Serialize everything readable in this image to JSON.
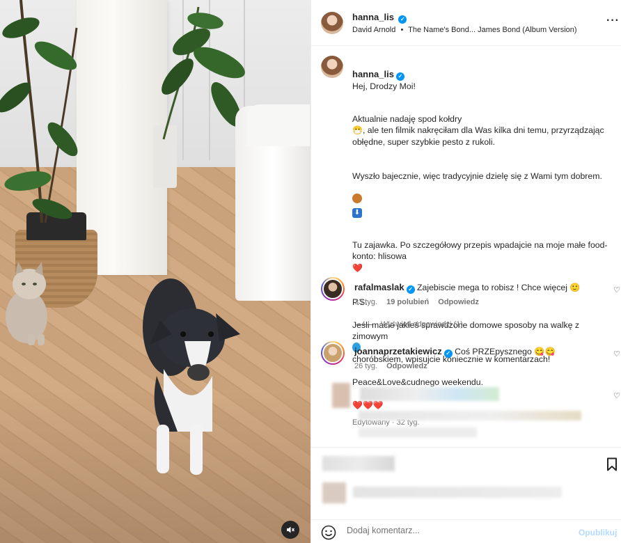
{
  "post": {
    "username": "hanna_lis",
    "verified": true,
    "music_artist": "David Arnold",
    "music_separator": "•",
    "music_track": "The Name's Bond... James Bond (Album Version)",
    "more_icon": "more-horizontal-icon"
  },
  "caption": {
    "username": "hanna_lis",
    "greeting": "Hej, Drodzy Moi!",
    "p1_a": "Aktualnie nadaję spod kołdry",
    "p1_b": ", ale ten filmik nakręciłam dla Was kilka dni temu, przyrządzając obłędne, super szybkie pesto z rukoli.",
    "p2": "Wyszło bajecznie, więc tradycyjnie dzielę się z Wami tym dobrem.",
    "p3": "Tu zajawka. Po szczegółowy przepis wpadajcie na moje małe food-konto: hlisowa",
    "p4_a": "P.S.",
    "p4_b": "Jeśli macie jakieś sprawdzone domowe sposoby na walkę z zimowym",
    "p4_c": "choróbskiem, wpisujcie koniecznie w komentarzach!",
    "p4_d": "Peace&Love&cudnego weekendu.",
    "emoji_sick": "😷",
    "emoji_heart": "❤️",
    "emoji_hearts": "❤️❤️❤️",
    "meta": "Edytowany · 32 tyg."
  },
  "comments": [
    {
      "username": "rafalmaslak",
      "verified": true,
      "text": "Zajebiscie mega to robisz ! Chce więcej",
      "emoji": "🙂",
      "time": "33 tyg.",
      "likes": "19 polubień",
      "reply": "Odpowiedz"
    },
    {
      "username": "joannaprzetakiewicz",
      "verified": true,
      "text": "Coś PRZEpysznego",
      "emoji": "😋😋",
      "time": "26 tyg.",
      "reply": "Odpowiedz"
    }
  ],
  "view_replies": "Wyświetl odpowiedzi (1)",
  "add_comment": {
    "placeholder": "Dodaj komentarz...",
    "publish": "Opublikuj"
  },
  "colors": {
    "accent": "#0095f6",
    "publish_disabled": "#b3dbff",
    "heart": "#ed4956"
  }
}
